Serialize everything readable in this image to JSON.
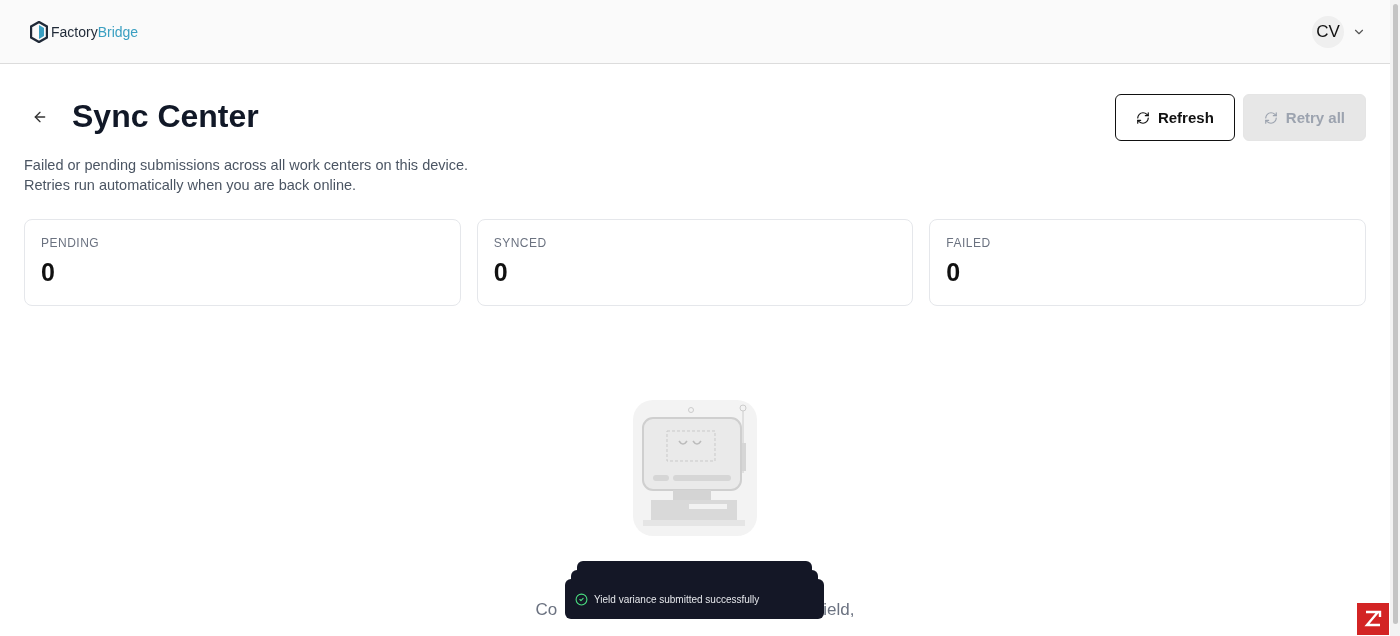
{
  "header": {
    "logo": {
      "part_1": "Factory",
      "part_2": "Bridge"
    },
    "user": {
      "initials": "CV"
    }
  },
  "page": {
    "title": "Sync Center",
    "description_lines": [
      "Failed or pending submissions across all work centers on this device.",
      "Retries run automatically when you are back online."
    ],
    "buttons": [
      {
        "label": "Refresh",
        "disabled": false
      },
      {
        "label": "Retry all",
        "disabled": true
      }
    ]
  },
  "stats": [
    {
      "label": "PENDING",
      "value": "0"
    },
    {
      "label": "SYNCED",
      "value": "0"
    },
    {
      "label": "FAILED",
      "value": "0"
    }
  ],
  "empty_state": {
    "visible_text_left": "Co",
    "visible_text_right": "ield,"
  },
  "toast": {
    "message": "Yield variance submitted successfully"
  }
}
